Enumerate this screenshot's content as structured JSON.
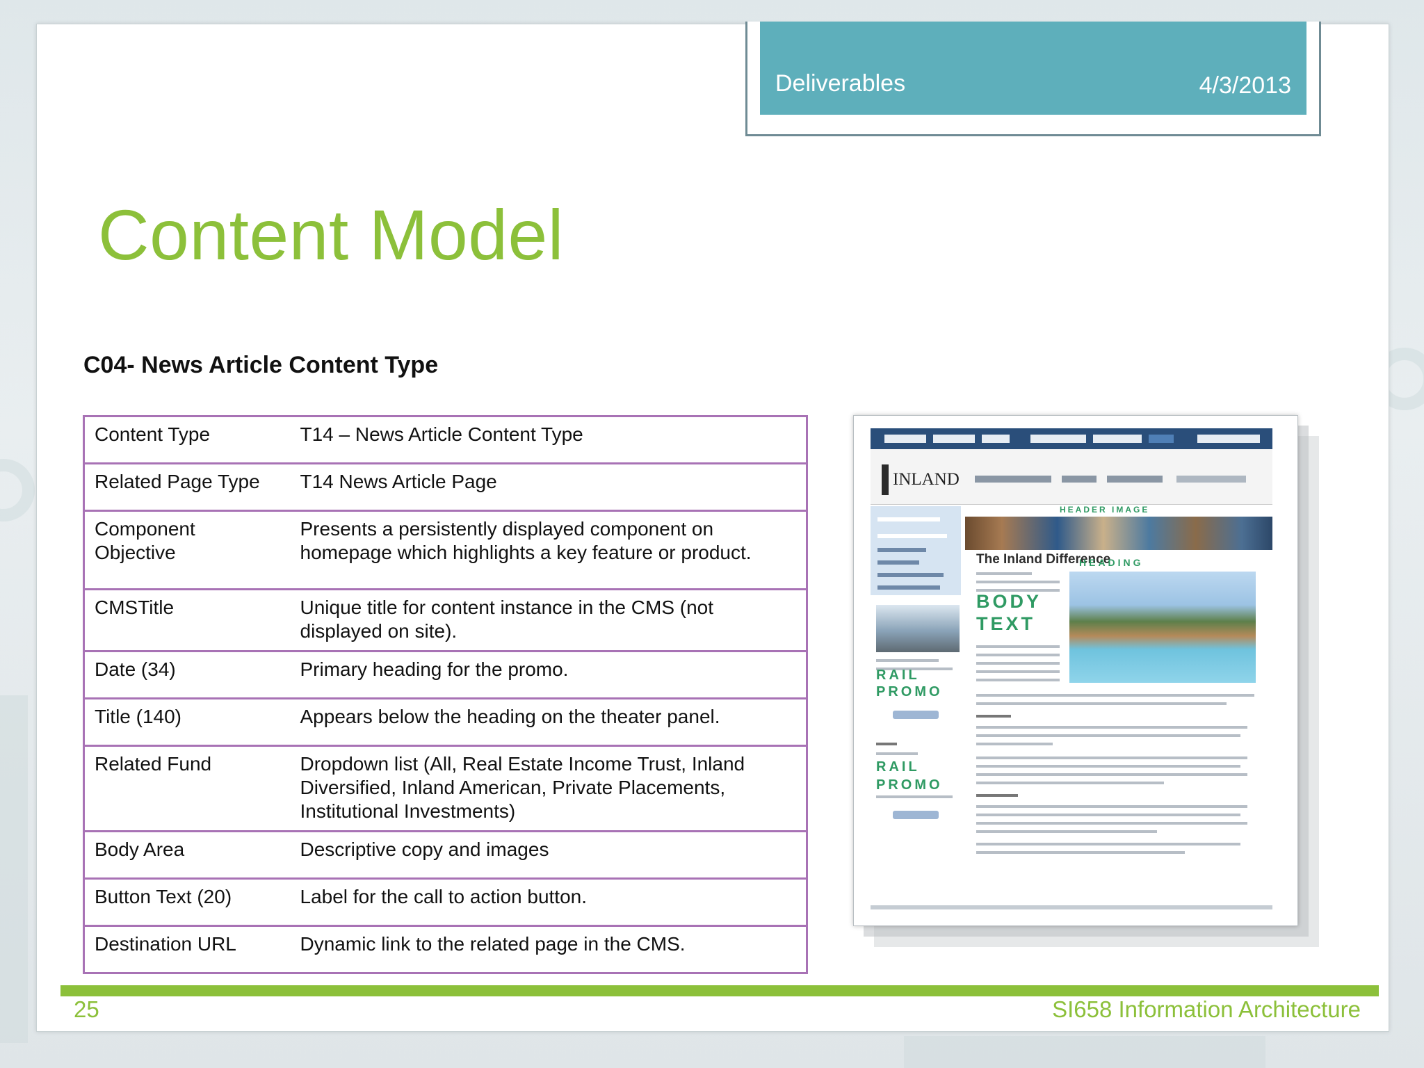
{
  "header": {
    "section_label": "Deliverables",
    "date": "4/3/2013"
  },
  "slide": {
    "title": "Content Model",
    "subheading": "C04- News Article Content Type",
    "slide_number": "25",
    "course": "SI658 Information Architecture"
  },
  "table": {
    "rows": [
      {
        "field": "Content Type",
        "description": "T14 – News Article Content Type"
      },
      {
        "field": "Related Page Type",
        "description": "T14 News Article Page"
      },
      {
        "field": "Component Objective",
        "description": "Presents a persistently displayed component on homepage which highlights a key feature or product."
      },
      {
        "field": "CMSTitle",
        "description": "Unique title for content instance in the CMS (not displayed on site)."
      },
      {
        "field": "Date (34)",
        "description": "Primary heading for the promo."
      },
      {
        "field": "Title (140)",
        "description": "Appears below the heading on the theater panel."
      },
      {
        "field": "Related Fund",
        "description": "Dropdown list (All, Real Estate Income Trust, Inland Diversified, Inland American, Private Placements, Institutional Investments)"
      },
      {
        "field": "Body Area",
        "description": "Descriptive copy and images"
      },
      {
        "field": "Button Text (20)",
        "description": "Label for the call to action button."
      },
      {
        "field": "Destination URL",
        "description": "Dynamic link to the related page in the CMS."
      }
    ]
  },
  "mockup": {
    "logo": "INLAND",
    "heading": "The Inland Difference",
    "labels": {
      "header_image": "HEADER IMAGE",
      "heading": "HEADING",
      "body_text_1": "BODY",
      "body_text_2": "TEXT",
      "rail_1": "RAIL",
      "promo_1": "PROMO",
      "rail_2": "RAIL",
      "promo_2": "PROMO"
    }
  }
}
